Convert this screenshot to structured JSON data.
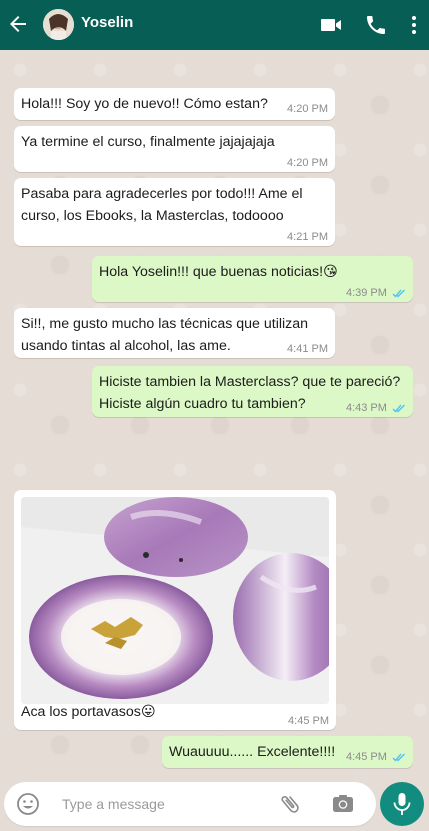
{
  "header": {
    "contact_name": "Yoselin",
    "back_icon": "back-arrow-icon",
    "icons": [
      "video-call-icon",
      "phone-icon",
      "more-vert-icon"
    ]
  },
  "messages": [
    {
      "dir": "in",
      "text": "Hola!!! Soy yo de nuevo!! Cómo estan?",
      "time": "4:20 PM"
    },
    {
      "dir": "in",
      "text": "Ya termine el curso, finalmente jajajajaja",
      "time": "4:20 PM"
    },
    {
      "dir": "in",
      "text": "Pasaba para agradecerles por todo!!! Ame el curso, los Ebooks, la Masterclas, todoooo",
      "time": "4:21 PM"
    },
    {
      "dir": "out",
      "text": "Hola Yoselin!!! que buenas noticias!😘",
      "time": "4:39 PM",
      "read": true
    },
    {
      "dir": "in",
      "text": "Si!!, me gusto mucho las técnicas que utilizan usando tintas al alcohol, las ame.",
      "time": "4:41 PM"
    },
    {
      "dir": "out",
      "text": "Hiciste tambien la Masterclass? que te pareció? Hiciste algún cuadro tu tambien?",
      "time": "4:43 PM",
      "read": true
    },
    {
      "dir": "in",
      "type": "image",
      "caption": "Aca los portavasos😛",
      "time": "4:45 PM"
    },
    {
      "dir": "out",
      "text": "Wuauuuu...... Excelente!!!!",
      "time": "4:45 PM",
      "read": true
    }
  ],
  "input": {
    "placeholder": "Type a message",
    "icons": [
      "emoji-icon",
      "attach-icon",
      "camera-icon",
      "mic-icon"
    ]
  },
  "colors": {
    "header": "#075e54",
    "chat_bg": "#e5ddd5",
    "outgoing": "#dcf8c6",
    "incoming": "#ffffff",
    "read_ticks": "#4fc3f7",
    "mic_button": "#128c7e"
  }
}
